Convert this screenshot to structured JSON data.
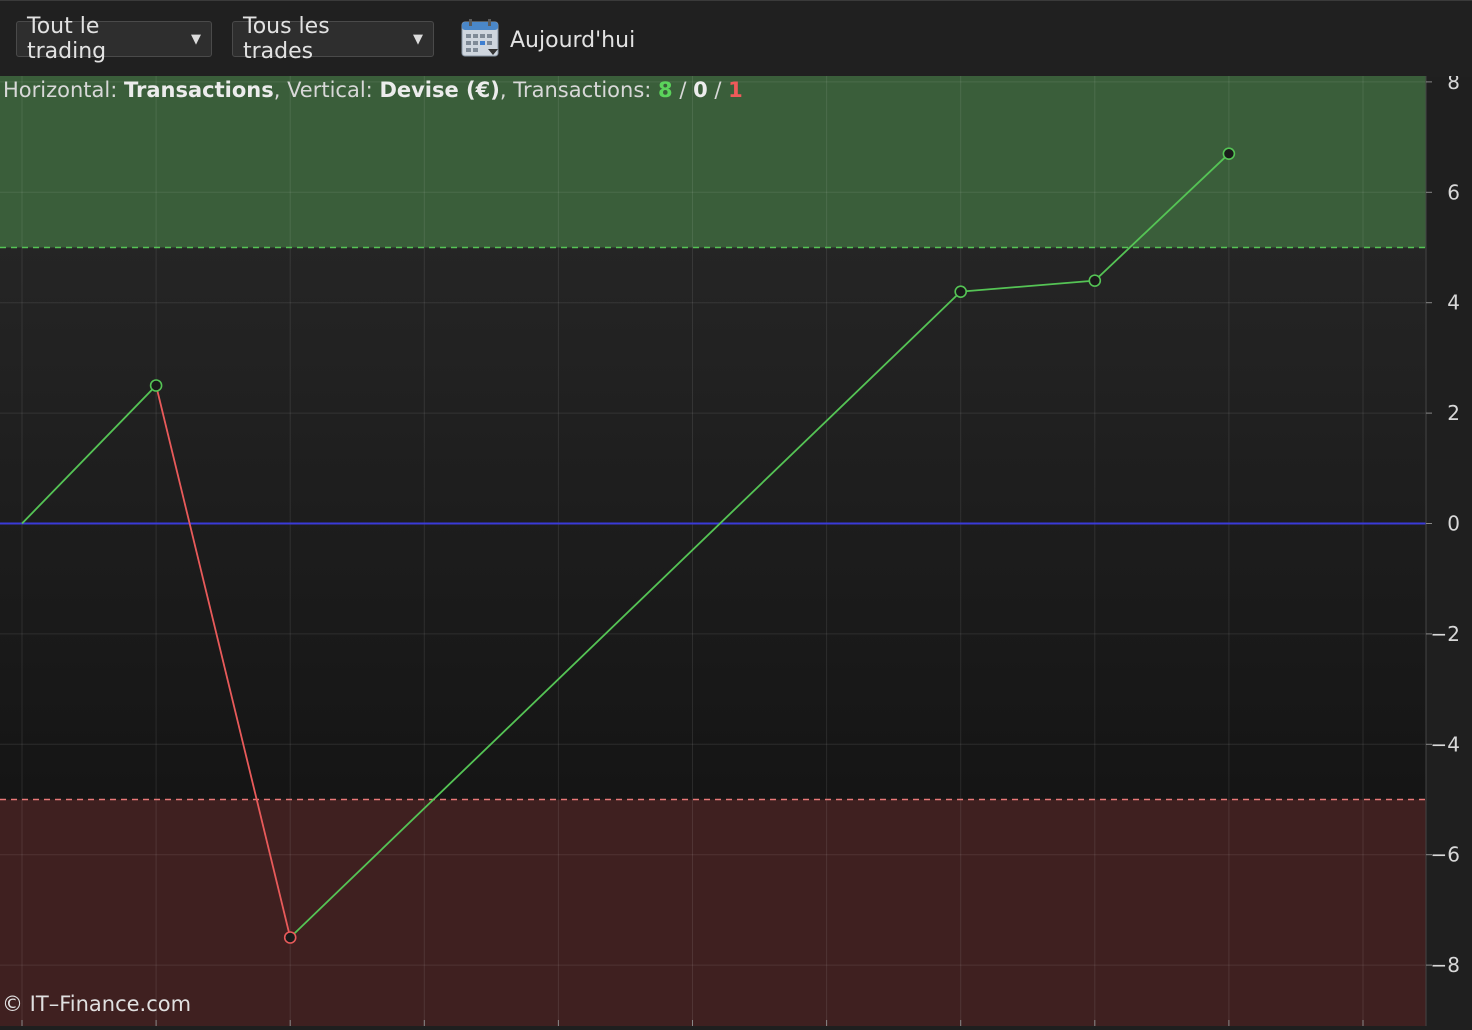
{
  "toolbar": {
    "filter_label": "Tout le trading",
    "trades_label": "Tous les trades",
    "date_label": "Aujourd'hui",
    "calendar_icon": "calendar-icon",
    "caret_icon": "chevron-down-icon"
  },
  "info": {
    "horizontal_prefix": "Horizontal: ",
    "horizontal_value": "Transactions",
    "vertical_prefix": ", Vertical: ",
    "vertical_value": "Devise (€)",
    "transactions_prefix": ", Transactions: ",
    "wins": "8",
    "neutral": "0",
    "losses": "1",
    "sep": " / "
  },
  "watermark": "© IT–Finance.com",
  "chart_data": {
    "type": "line",
    "x": [
      0,
      1,
      2,
      7,
      8,
      9
    ],
    "y": [
      0,
      2.5,
      -7.5,
      4.2,
      4.4,
      6.7
    ],
    "xlim": [
      0,
      10.5
    ],
    "ylim": [
      -9.1,
      8.1
    ],
    "yticks": [
      8,
      6,
      4,
      2,
      0,
      -2,
      -4,
      -6,
      -8
    ],
    "ytick_labels": [
      "8",
      "6",
      "4",
      "2",
      "0",
      "−2",
      "−4",
      "−6",
      "−8"
    ],
    "xgrid": [
      0,
      1,
      2,
      3,
      4,
      5,
      6,
      7,
      8,
      9,
      10
    ],
    "upper_threshold": 5,
    "lower_threshold": -5,
    "grid": true,
    "colors": {
      "gain": "#55c455",
      "loss": "#e85a5a",
      "zero": "#3a3ad8",
      "upper_zone": "#3a5e3a",
      "lower_zone": "#3f2020",
      "grid": "#3b3b3b"
    }
  }
}
